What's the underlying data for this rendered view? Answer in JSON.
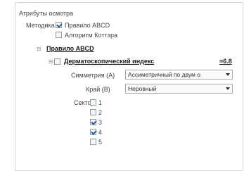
{
  "section_title": "Атрибуты осмотра",
  "method": {
    "label": "Методика",
    "options": [
      {
        "label": "Правило ABCD",
        "checked": true
      },
      {
        "label": "Алгоритм Коттэра",
        "checked": false
      }
    ]
  },
  "rule_heading": "Правило ABCD",
  "index_heading": "Дерматоскопический индекс",
  "index_value": "=6.8",
  "fields": [
    {
      "label": "Симметрия (А)",
      "value": "Ассиметричный по двум о"
    },
    {
      "label": "Край (В)",
      "value": "Неровный"
    }
  ],
  "sector": {
    "label": "Сектор",
    "items": [
      {
        "label": "1",
        "checked": false
      },
      {
        "label": "2",
        "checked": false
      },
      {
        "label": "3",
        "checked": true
      },
      {
        "label": "4",
        "checked": true
      },
      {
        "label": "5",
        "checked": false
      }
    ]
  }
}
